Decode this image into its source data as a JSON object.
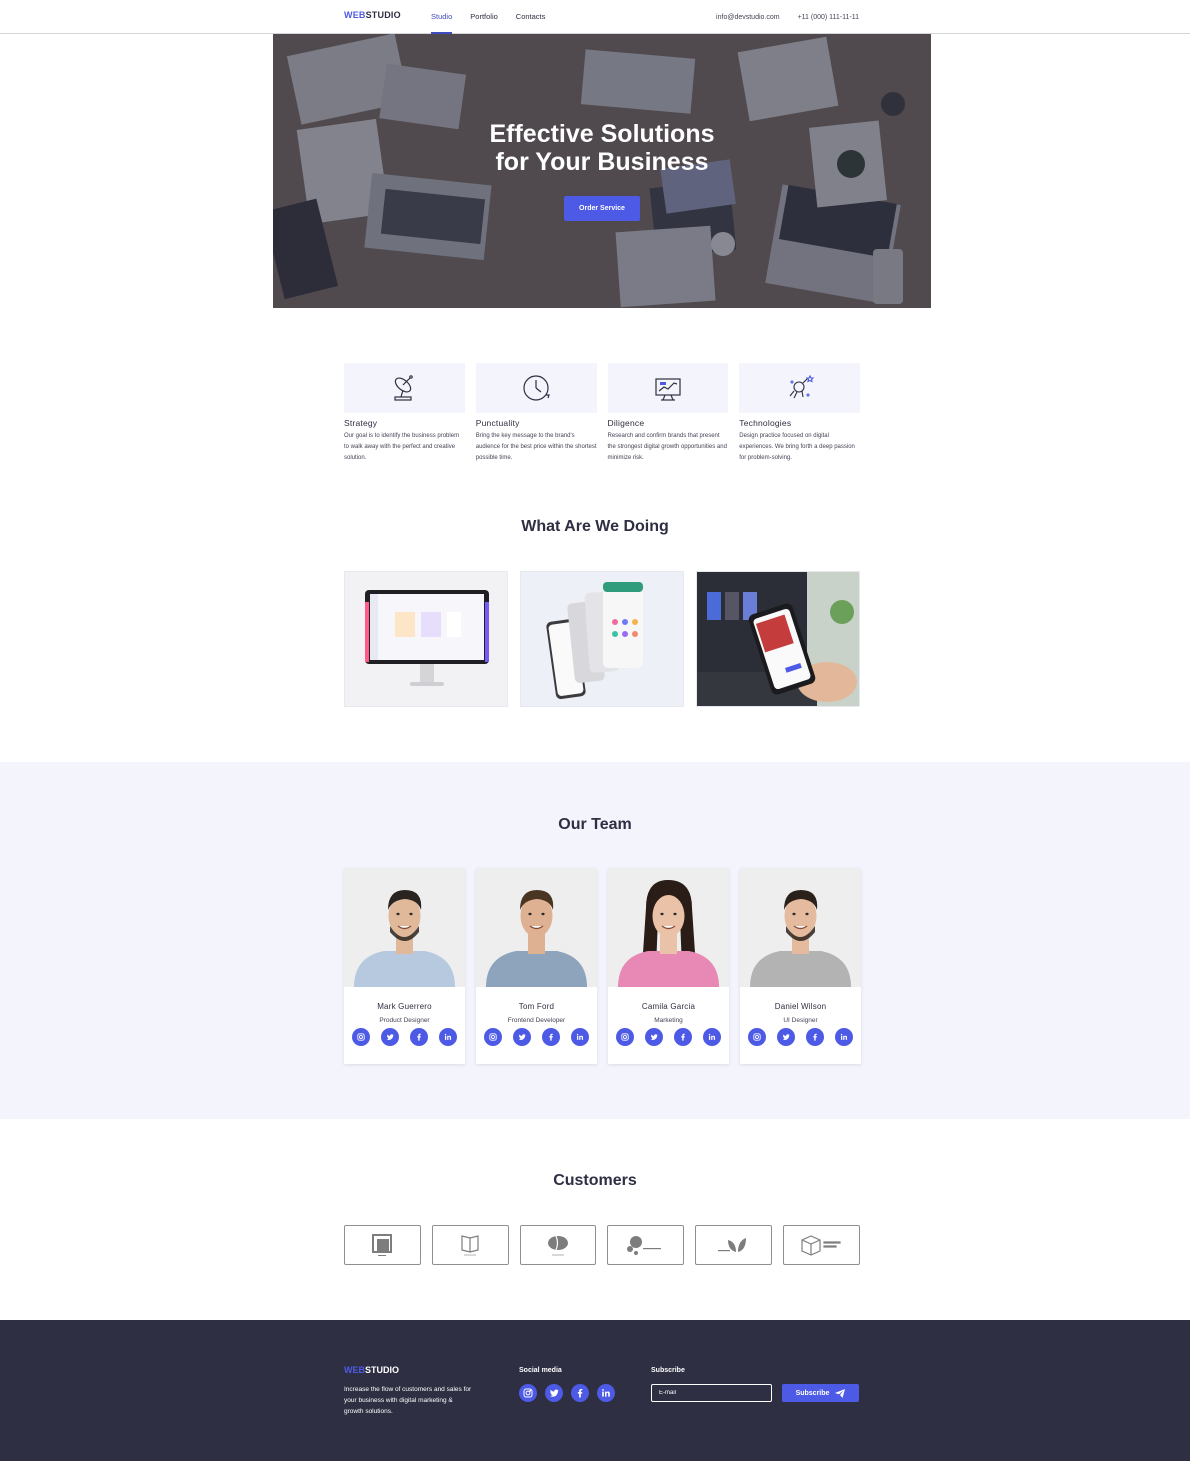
{
  "header": {
    "logo_accent": "WEB",
    "logo_rest": "STUDIO",
    "nav": [
      {
        "label": "Studio",
        "active": true
      },
      {
        "label": "Portfolio",
        "active": false
      },
      {
        "label": "Contacts",
        "active": false
      }
    ],
    "email": "info@devstudio.com",
    "phone": "+11 (000) 111-11-11"
  },
  "hero": {
    "title_line1": "Effective Solutions",
    "title_line2": "for Your Business",
    "button": "Order Service"
  },
  "features": [
    {
      "icon": "satellite-dish-icon",
      "title": "Strategy",
      "text": "Our goal is to identify the business problem to walk away with the perfect and creative solution."
    },
    {
      "icon": "clock-icon",
      "title": "Punctuality",
      "text": "Bring the key message to the brand's audience for the best price within the shortest possible time."
    },
    {
      "icon": "monitor-chart-icon",
      "title": "Diligence",
      "text": "Research and confirm brands that present the strongest digital growth opportunities and minimize risk."
    },
    {
      "icon": "rocket-astronaut-icon",
      "title": "Technologies",
      "text": "Design practice focused on digital experiences. We bring forth a deep passion for problem-solving."
    }
  ],
  "works_title": "What Are We Doing",
  "works": [
    {
      "icon": "desktop-dashboard-image"
    },
    {
      "icon": "mobile-app-screens-image"
    },
    {
      "icon": "phone-in-hand-image"
    }
  ],
  "team_title": "Our Team",
  "team": [
    {
      "name": "Mark Guerrero",
      "role": "Product Designer",
      "shirt": "#b7c9de",
      "hair": "#2a2421",
      "beard": true,
      "skin": "#e0b89a"
    },
    {
      "name": "Tom Ford",
      "role": "Frontend Developer",
      "shirt": "#8ea4bd",
      "hair": "#4a3422",
      "beard": false,
      "skin": "#dfb193"
    },
    {
      "name": "Camila Garcia",
      "role": "Marketing",
      "shirt": "#e888b4",
      "hair": "#2a1c16",
      "beard": false,
      "skin": "#eac2a8"
    },
    {
      "name": "Daniel Wilson",
      "role": "UI Designer",
      "shirt": "#b3b3b3",
      "hair": "#2b211b",
      "beard": true,
      "skin": "#e4bb9e"
    }
  ],
  "socials": [
    "instagram-icon",
    "twitter-icon",
    "facebook-icon",
    "linkedin-icon"
  ],
  "customers_title": "Customers",
  "customers": [
    "customer-logo-1",
    "customer-logo-2",
    "customer-logo-3",
    "customer-logo-4",
    "customer-logo-5",
    "customer-logo-6"
  ],
  "footer": {
    "logo_accent": "WEB",
    "logo_rest": "STUDIO",
    "text": "Increase the flow of customers and sales for your business with digital marketing & growth solutions.",
    "social_heading": "Social media",
    "subscribe_heading": "Subscribe",
    "email_placeholder": "E-mail",
    "subscribe_button": "Subscribe"
  },
  "colors": {
    "accent": "#4d5ae5",
    "dark": "#2e2f42",
    "light_bg": "#f4f4fd"
  }
}
